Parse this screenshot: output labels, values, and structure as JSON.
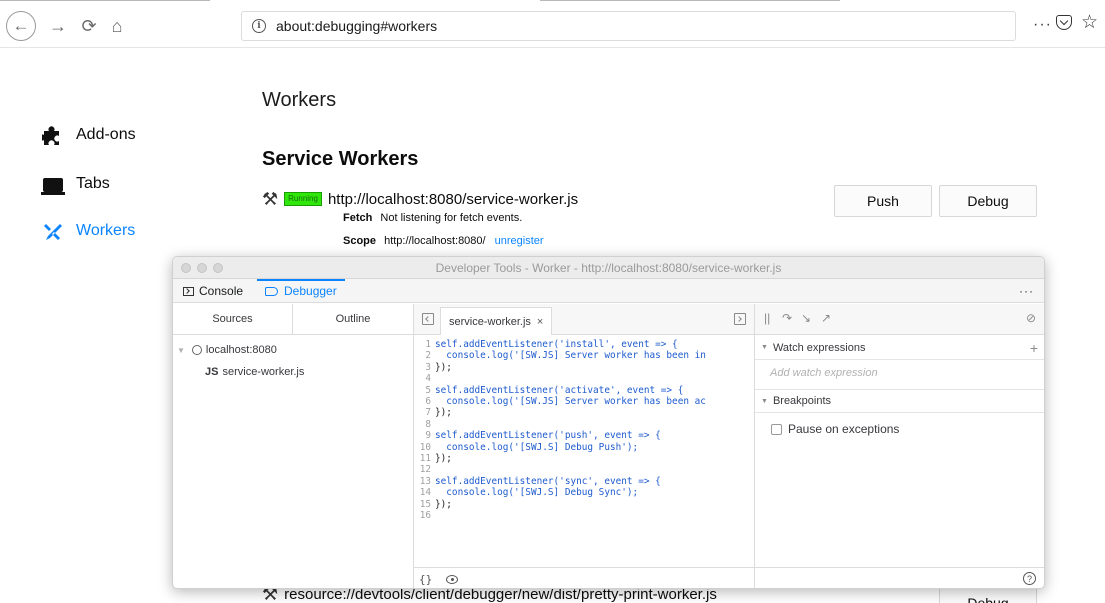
{
  "browser": {
    "url": "about:debugging#workers",
    "page_actions_glyph": "···",
    "icons": [
      "back-icon",
      "forward-icon",
      "reload-icon",
      "home-icon",
      "info-icon",
      "pocket-icon",
      "bookmark-star-icon"
    ]
  },
  "sidebar": {
    "items": [
      {
        "label": "Add-ons",
        "icon": "puzzle-icon"
      },
      {
        "label": "Tabs",
        "icon": "tabs-icon"
      },
      {
        "label": "Workers",
        "icon": "tools-icon"
      }
    ],
    "active_color": "#0a84ff"
  },
  "main": {
    "title": "Workers",
    "section_title": "Service Workers",
    "worker": {
      "status": "Running",
      "url": "http://localhost:8080/service-worker.js",
      "fetch_label": "Fetch",
      "fetch_value": "Not listening for fetch events.",
      "scope_label": "Scope",
      "scope_value": "http://localhost:8080/",
      "unregister": "unregister",
      "push_button": "Push",
      "debug_button": "Debug"
    },
    "worker2": {
      "url": "resource://devtools/client/debugger/new/dist/pretty-print-worker.js",
      "debug_button": "Debug"
    }
  },
  "devtools": {
    "window_title": "Developer Tools - Worker - http://localhost:8080/service-worker.js",
    "tabs": {
      "console": "Console",
      "debugger": "Debugger"
    },
    "menu_glyph": "···",
    "sources_tabs": {
      "sources": "Sources",
      "outline": "Outline"
    },
    "tree": {
      "root": "localhost:8080",
      "file_icon": "JS",
      "file": "service-worker.js"
    },
    "editor": {
      "file_tab": "service-worker.js",
      "close_glyph": "×",
      "pretty_print_glyph": "{}",
      "lines": [
        {
          "n": "1",
          "text": "self.addEventListener('install', event => {"
        },
        {
          "n": "2",
          "text": "  console.log('[SW.JS] Server worker has been in"
        },
        {
          "n": "3",
          "text": "});"
        },
        {
          "n": "4",
          "text": ""
        },
        {
          "n": "5",
          "text": "self.addEventListener('activate', event => {"
        },
        {
          "n": "6",
          "text": "  console.log('[SW.JS] Server worker has been ac"
        },
        {
          "n": "7",
          "text": "});"
        },
        {
          "n": "8",
          "text": ""
        },
        {
          "n": "9",
          "text": "self.addEventListener('push', event => {"
        },
        {
          "n": "10",
          "text": "  console.log('[SWJ.S] Debug Push');"
        },
        {
          "n": "11",
          "text": "});"
        },
        {
          "n": "12",
          "text": ""
        },
        {
          "n": "13",
          "text": "self.addEventListener('sync', event => {"
        },
        {
          "n": "14",
          "text": "  console.log('[SWJ.S] Debug Sync');"
        },
        {
          "n": "15",
          "text": "});"
        },
        {
          "n": "16",
          "text": ""
        }
      ]
    },
    "right_panel": {
      "command_glyphs": {
        "pause": "||",
        "step_over": "↷",
        "step_in": "↘",
        "step_out": "↗",
        "deactivate": "⊘"
      },
      "watch_title": "Watch expressions",
      "watch_add_glyph": "+",
      "watch_placeholder": "Add watch expression",
      "breakpoints_title": "Breakpoints",
      "pause_on_exceptions": "Pause on exceptions",
      "help_glyph": "?"
    }
  },
  "colors": {
    "accent": "#0a84ff",
    "running_badge": "#30e60b"
  }
}
